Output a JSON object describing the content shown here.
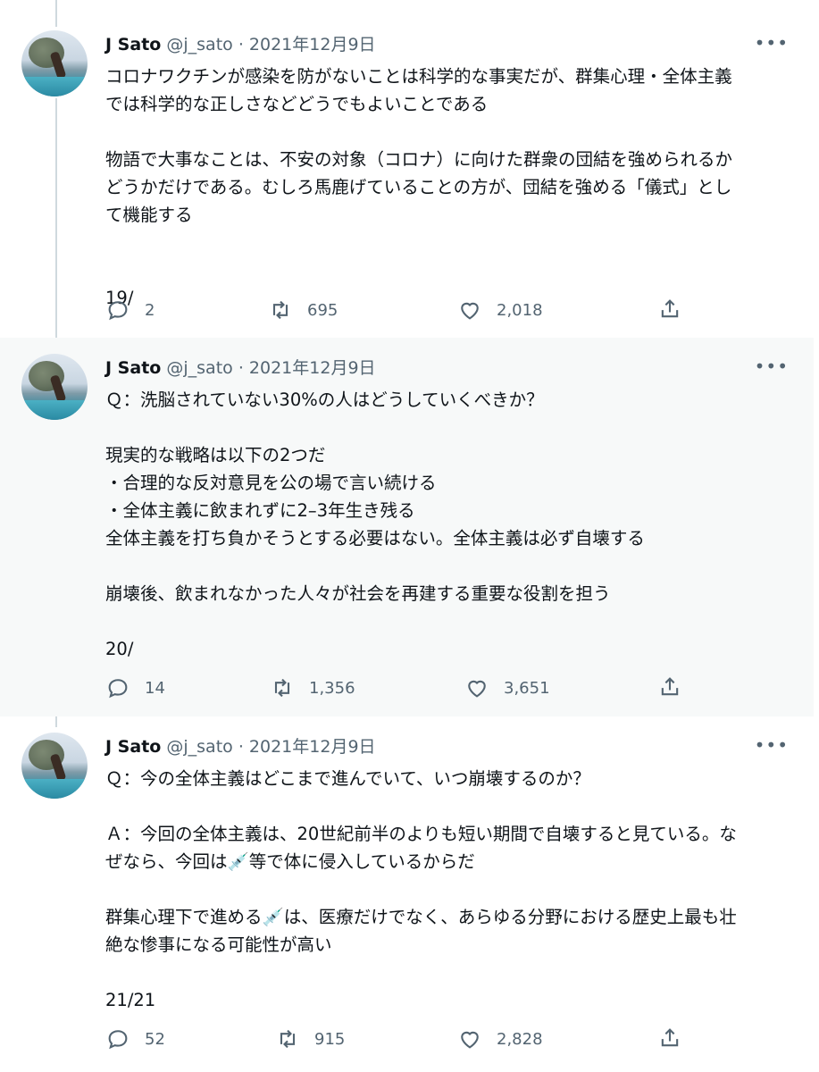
{
  "author": {
    "name": "J Sato",
    "handle": "@j_sato",
    "date": "2021年12月9日"
  },
  "more_icon": "more-horizontal-icon",
  "tweets": [
    {
      "paragraphs": [
        [
          "コロナワクチンが感染を防がないことは科学的な事実だが、群集心理・全体主義",
          "では科学的な正しさなどどうでもよいことである"
        ],
        [
          "物語で大事なことは、不安の対象（コロナ）に向けた群衆の団結を強められるか",
          "どうかだけである。むしろ馬鹿げていることの方が、団結を強める「儀式」とし",
          "て機能する"
        ],
        [
          "19/"
        ]
      ],
      "replies": "2",
      "retweets": "695",
      "likes": "2,018"
    },
    {
      "paragraphs": [
        [
          "Ｑ：洗脳されていない30%の人はどうしていくべきか？"
        ],
        [
          "現実的な戦略は以下の2つだ",
          "・合理的な反対意見を公の場で言い続ける",
          "・全体主義に飲まれずに2–3年生き残る",
          "全体主義を打ち負かそうとする必要はない。全体主義は必ず自壊する"
        ],
        [
          "崩壊後、飲まれなかった人々が社会を再建する重要な役割を担う"
        ],
        [
          "20/"
        ]
      ],
      "replies": "14",
      "retweets": "1,356",
      "likes": "3,651"
    },
    {
      "paragraphs": [
        [
          "Ｑ：今の全体主義はどこまで進んでいて、いつ崩壊するのか？"
        ],
        [
          "Ａ：今回の全体主義は、20世紀前半のよりも短い期間で自壊すると見ている。な",
          "ぜなら、今回は💉等で体に侵入しているからだ"
        ],
        [
          "群集心理下で進める💉は、医療だけでなく、あらゆる分野における歴史上最も壮",
          "絶な惨事になる可能性が高い"
        ],
        [
          "21/21"
        ]
      ],
      "replies": "52",
      "retweets": "915",
      "likes": "2,828"
    }
  ]
}
